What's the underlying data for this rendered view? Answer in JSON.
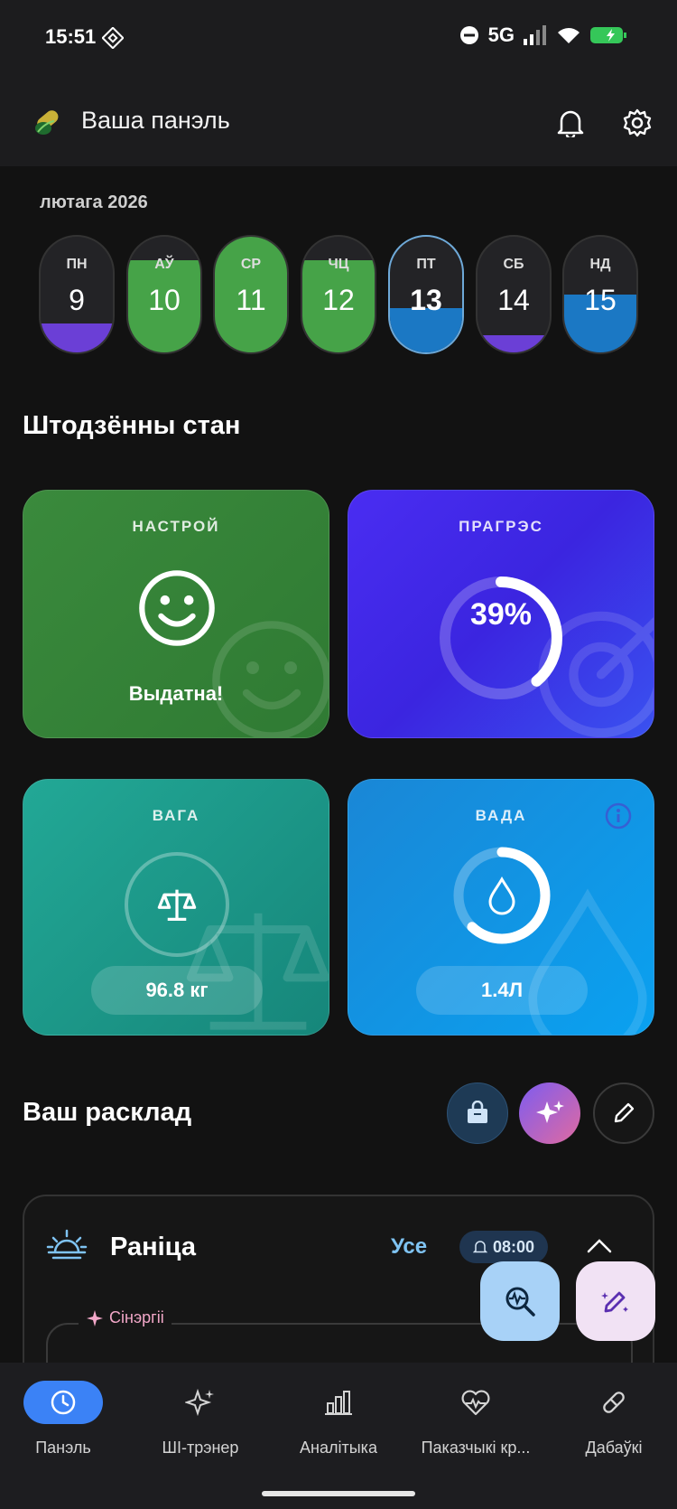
{
  "status_bar": {
    "time": "15:51",
    "network": "5G"
  },
  "header": {
    "title": "Ваша панэль"
  },
  "calendar": {
    "month": "лютага 2026",
    "days": [
      {
        "weekday": "ПН",
        "day": "9",
        "fill": 0.25,
        "color": "#6b3fd6"
      },
      {
        "weekday": "АЎ",
        "day": "10",
        "fill": 0.8,
        "color": "#46a348"
      },
      {
        "weekday": "СР",
        "day": "11",
        "fill": 1.0,
        "color": "#46a348"
      },
      {
        "weekday": "ЧЦ",
        "day": "12",
        "fill": 0.8,
        "color": "#46a348"
      },
      {
        "weekday": "ПТ",
        "day": "13",
        "fill": 0.38,
        "color": "#1b78c4",
        "today": true
      },
      {
        "weekday": "СБ",
        "day": "14",
        "fill": 0.15,
        "color": "#6b3fd6"
      },
      {
        "weekday": "НД",
        "day": "15",
        "fill": 0.5,
        "color": "#1b78c4"
      }
    ]
  },
  "daily": {
    "title": "Штодзённы стан",
    "mood": {
      "label": "НАСТРОЙ",
      "value": "Выдатна!"
    },
    "progress": {
      "label": "ПРАГРЭС",
      "value_text": "39%",
      "fraction": 0.39
    },
    "weight": {
      "label": "ВАГА",
      "value": "96.8 кг"
    },
    "water": {
      "label": "ВАДА",
      "value": "1.4Л",
      "fraction": 0.62
    }
  },
  "schedule": {
    "title": "Ваш расклад",
    "routine": {
      "title": "Раніца",
      "all_label": "Усе",
      "time": "08:00",
      "synergy_label": "Сінэргіі"
    }
  },
  "nav": {
    "items": [
      {
        "label": "Панэль",
        "icon": "clock-icon",
        "active": true
      },
      {
        "label": "ШІ-трэнер",
        "icon": "sparkles-icon"
      },
      {
        "label": "Аналітыка",
        "icon": "bar-chart-icon"
      },
      {
        "label": "Паказчыкі кр...",
        "icon": "heart-pulse-icon"
      },
      {
        "label": "Дабаўкі",
        "icon": "pill-icon"
      }
    ]
  }
}
